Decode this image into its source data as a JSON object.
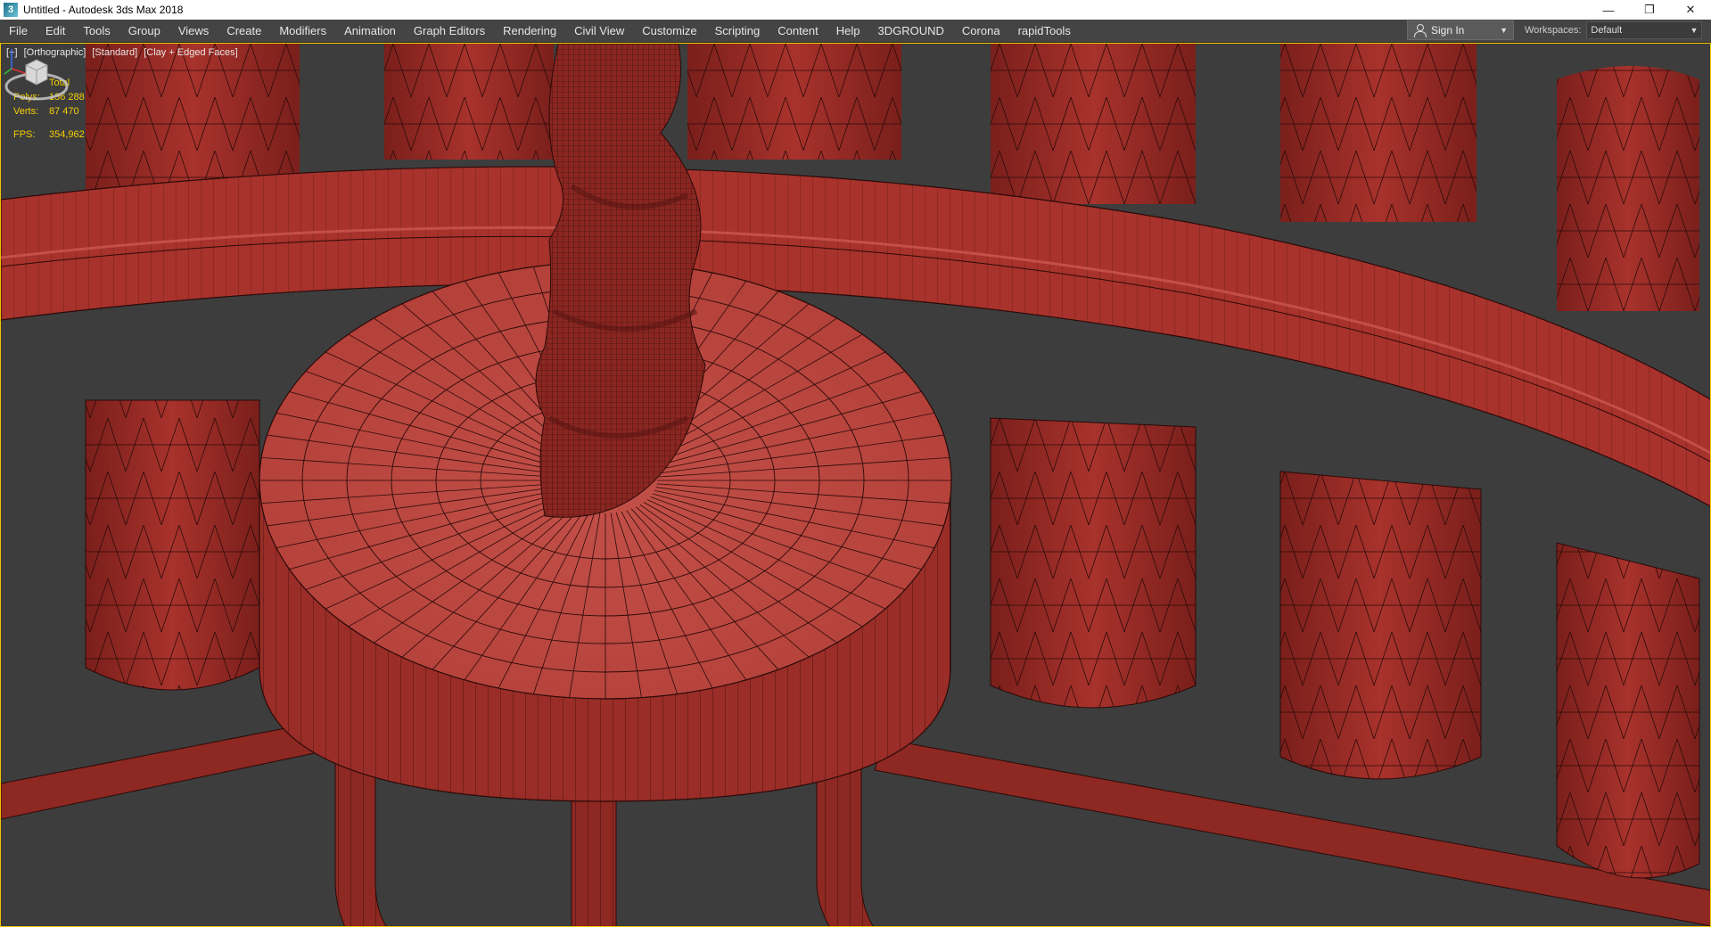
{
  "window": {
    "title": "Untitled - Autodesk 3ds Max 2018",
    "app_icon": "3",
    "buttons": {
      "minimize": "—",
      "restore": "❐",
      "close": "✕"
    }
  },
  "menu": {
    "items": [
      "File",
      "Edit",
      "Tools",
      "Group",
      "Views",
      "Create",
      "Modifiers",
      "Animation",
      "Graph Editors",
      "Rendering",
      "Civil View",
      "Customize",
      "Scripting",
      "Content",
      "Help",
      "3DGROUND",
      "Corona",
      "rapidTools"
    ]
  },
  "signin": {
    "label": "Sign In"
  },
  "workspaces": {
    "label": "Workspaces:",
    "value": "Default"
  },
  "viewport": {
    "labels": [
      "[+]",
      "[Orthographic]",
      "[Standard]",
      "[Clay + Edged Faces]"
    ],
    "stats": {
      "header": "Total",
      "polys_label": "Polys:",
      "polys": "136 288",
      "verts_label": "Verts:",
      "verts": "87 470",
      "fps_label": "FPS:",
      "fps": "354,962"
    }
  },
  "colors": {
    "clay": "#a8322c",
    "clay_dark": "#7a1f1b",
    "clay_light": "#c25048",
    "wire": "#2a0a08",
    "viewport_bg": "#3d3d3d",
    "stat_text": "#f5d000",
    "active_border": "#f0c400"
  }
}
